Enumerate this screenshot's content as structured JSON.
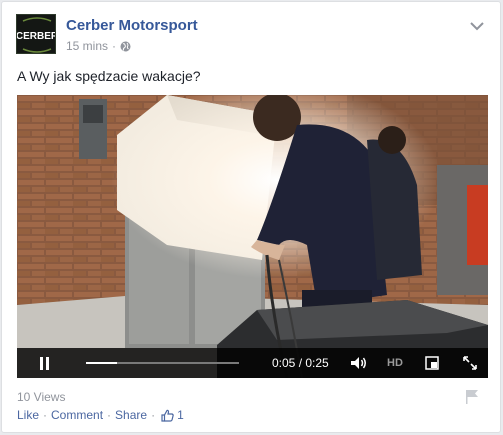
{
  "post": {
    "page_name": "Cerber Motorsport",
    "avatar_text": "CERBER",
    "timestamp": "15 mins",
    "meta_separator": "·",
    "text": "A Wy jak spędzacie wakacje?"
  },
  "video": {
    "current_time": "0:05",
    "duration": "0:25",
    "time_display": "0:05 / 0:25",
    "progress": 0.2,
    "hd_label": "HD"
  },
  "footer": {
    "views": "10 Views",
    "like_label": "Like",
    "comment_label": "Comment",
    "share_label": "Share",
    "separator": "·",
    "like_count": "1"
  },
  "icons": {
    "privacy": "globe-icon",
    "menu": "chevron-down-icon",
    "pause": "pause-icon",
    "volume": "volume-icon",
    "pip": "picture-in-picture-icon",
    "fullscreen": "fullscreen-icon",
    "flag": "flag-icon",
    "like": "thumbs-up-icon"
  },
  "colors": {
    "link": "#365899",
    "secondary_text": "#90949c",
    "card_bg": "#ffffff",
    "page_bg": "#e9ebee"
  }
}
